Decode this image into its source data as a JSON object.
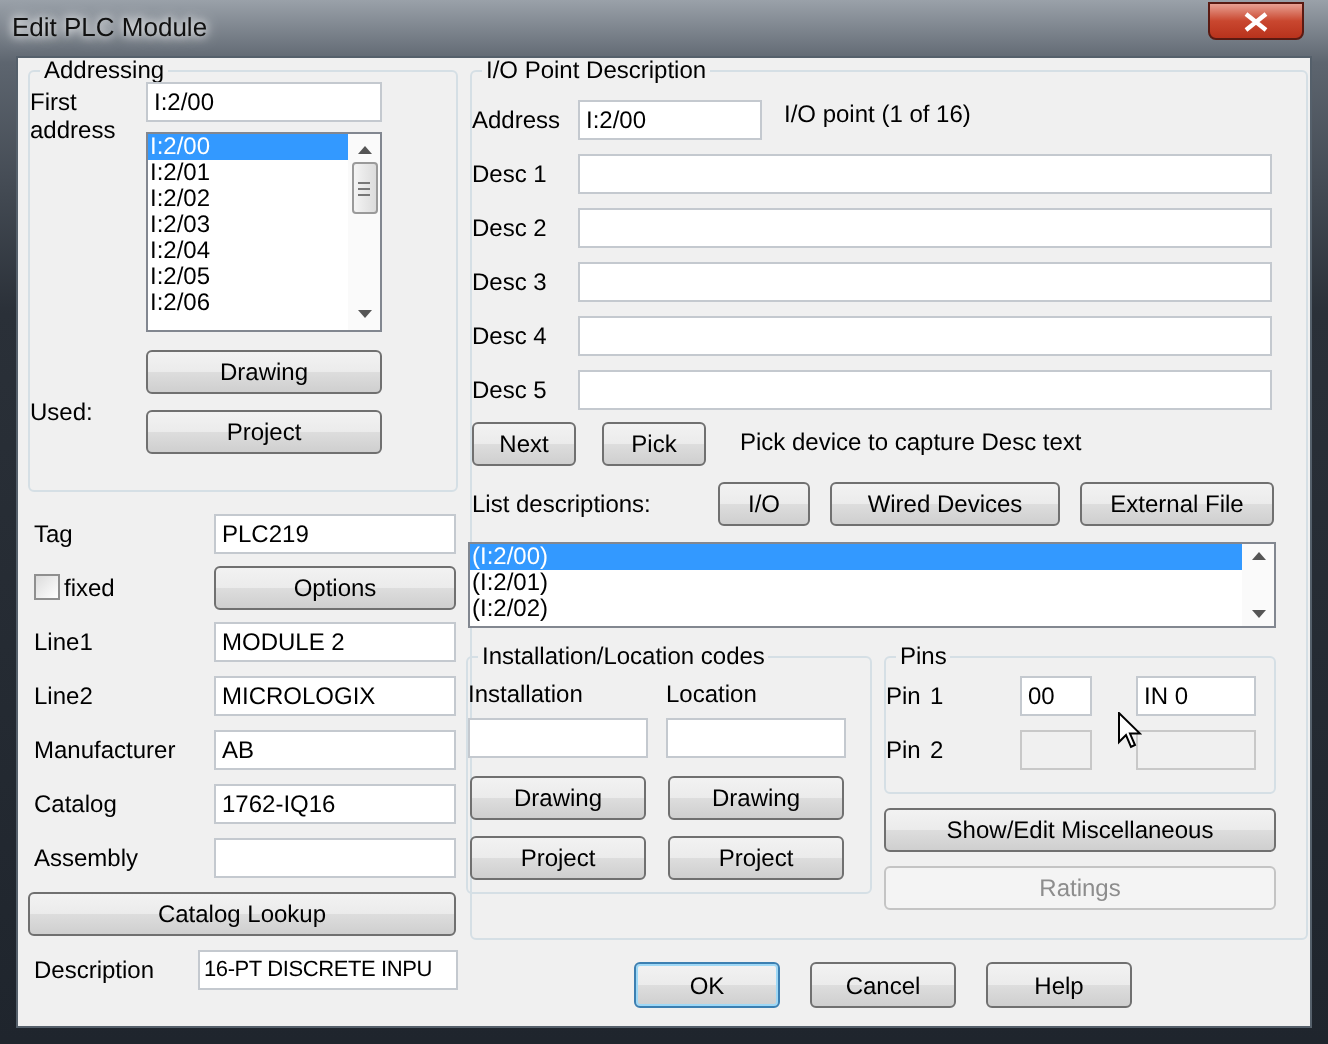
{
  "window": {
    "title": "Edit PLC Module"
  },
  "addressing": {
    "title": "Addressing",
    "first_address_label": "First address",
    "first_address": "I:2/00",
    "addresses": [
      {
        "label": "I:2/00",
        "selected": true
      },
      {
        "label": "I:2/01",
        "selected": false
      },
      {
        "label": "I:2/02",
        "selected": false
      },
      {
        "label": "I:2/03",
        "selected": false
      },
      {
        "label": "I:2/04",
        "selected": false
      },
      {
        "label": "I:2/05",
        "selected": false
      },
      {
        "label": "I:2/06",
        "selected": false
      }
    ],
    "used_label": "Used:",
    "buttons": [
      "Drawing",
      "Project"
    ]
  },
  "properties": {
    "tag_label": "Tag",
    "tag": "PLC219",
    "fixed": {
      "label": "fixed",
      "checked": false
    },
    "options_button": "Options",
    "fields": [
      {
        "label": "Line1",
        "value": "MODULE 2"
      },
      {
        "label": "Line2",
        "value": "MICROLOGIX"
      },
      {
        "label": "Manufacturer",
        "value": "AB"
      },
      {
        "label": "Catalog",
        "value": "1762-IQ16"
      },
      {
        "label": "Assembly"
      }
    ],
    "catalog_lookup": "Catalog Lookup",
    "description_label": "Description",
    "description": "16-PT DISCRETE INPU"
  },
  "io_point": {
    "title": "I/O Point Description",
    "address_label": "Address",
    "address": "I:2/00",
    "point_info": "I/O point (1 of 16)",
    "descs": [
      {
        "label": "Desc 1"
      },
      {
        "label": "Desc 2"
      },
      {
        "label": "Desc 3"
      },
      {
        "label": "Desc 4"
      },
      {
        "label": "Desc 5"
      }
    ],
    "next_button": "Next",
    "pick_button": "Pick",
    "pick_hint": "Pick device to capture Desc text",
    "list_label": "List descriptions:",
    "list_buttons": [
      "I/O",
      "Wired Devices",
      "External File"
    ],
    "descriptions": [
      {
        "label": "(I:2/00)",
        "selected": true
      },
      {
        "label": "(I:2/01)",
        "selected": false
      },
      {
        "label": "(I:2/02)",
        "selected": false
      }
    ]
  },
  "codes": {
    "title": "Installation/Location codes",
    "columns": [
      {
        "label": "Installation",
        "buttons": [
          "Drawing",
          "Project"
        ]
      },
      {
        "label": "Location",
        "buttons": [
          "Drawing",
          "Project"
        ]
      }
    ]
  },
  "pins": {
    "title": "Pins",
    "rows": [
      {
        "label": "Pin",
        "number": "1",
        "code": "00",
        "name": "IN 0",
        "disabled": false
      },
      {
        "label": "Pin",
        "number": "2",
        "disabled": true
      }
    ]
  },
  "misc_button": {
    "label": "Show/Edit Miscellaneous",
    "disabled": false
  },
  "ratings_button": {
    "label": "Ratings",
    "disabled": true
  },
  "footer": [
    {
      "label": "OK",
      "default": true
    },
    {
      "label": "Cancel",
      "default": false
    },
    {
      "label": "Help",
      "default": false
    }
  ]
}
